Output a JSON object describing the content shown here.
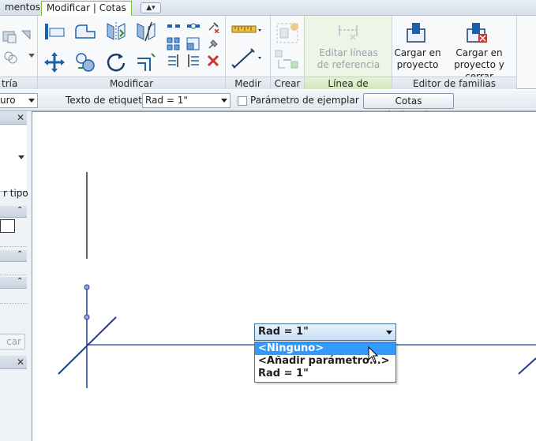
{
  "tabs": {
    "items": [
      {
        "label": "mentos"
      },
      {
        "label": "Modificar | Cotas"
      }
    ],
    "active_index": 1,
    "qat_label": "▲▾"
  },
  "ribbon": {
    "panels": [
      {
        "label": "tría"
      },
      {
        "label": "Modificar"
      },
      {
        "label": "Medir"
      },
      {
        "label": "Crear"
      },
      {
        "label": "Línea de referencia"
      },
      {
        "label": "Editor de familias"
      }
    ],
    "ref_line_button": {
      "label_line1": "Editar líneas",
      "label_line2": "de referencia",
      "enabled": false
    },
    "load_button": {
      "label_line1": "Cargar en",
      "label_line2": "proyecto"
    },
    "load_close_button": {
      "label_line1": "Cargar en",
      "label_line2": "proyecto y cerrar"
    }
  },
  "options_bar": {
    "left_combo_value": "uro",
    "label_text_caption": "Texto de etiqueta:",
    "label_text_value": "Rad = 1\"",
    "instance_param_label": "Parámetro de ejemplar",
    "instance_param_checked": false,
    "related_dims_button": "Cotas relacionadas"
  },
  "properties": {
    "type_label": "r tipo",
    "apply_button": "car"
  },
  "canvas": {
    "dropdown": {
      "value": "Rad = 1\"",
      "options": [
        "<Ninguno>",
        "<Añadir parámetro...>",
        "Rad = 1\""
      ],
      "selected_index": 0
    },
    "line_color": "#1f3d8c"
  },
  "colors": {
    "active_tab_border": "#7fbf2f",
    "selection": "#3399ff"
  }
}
